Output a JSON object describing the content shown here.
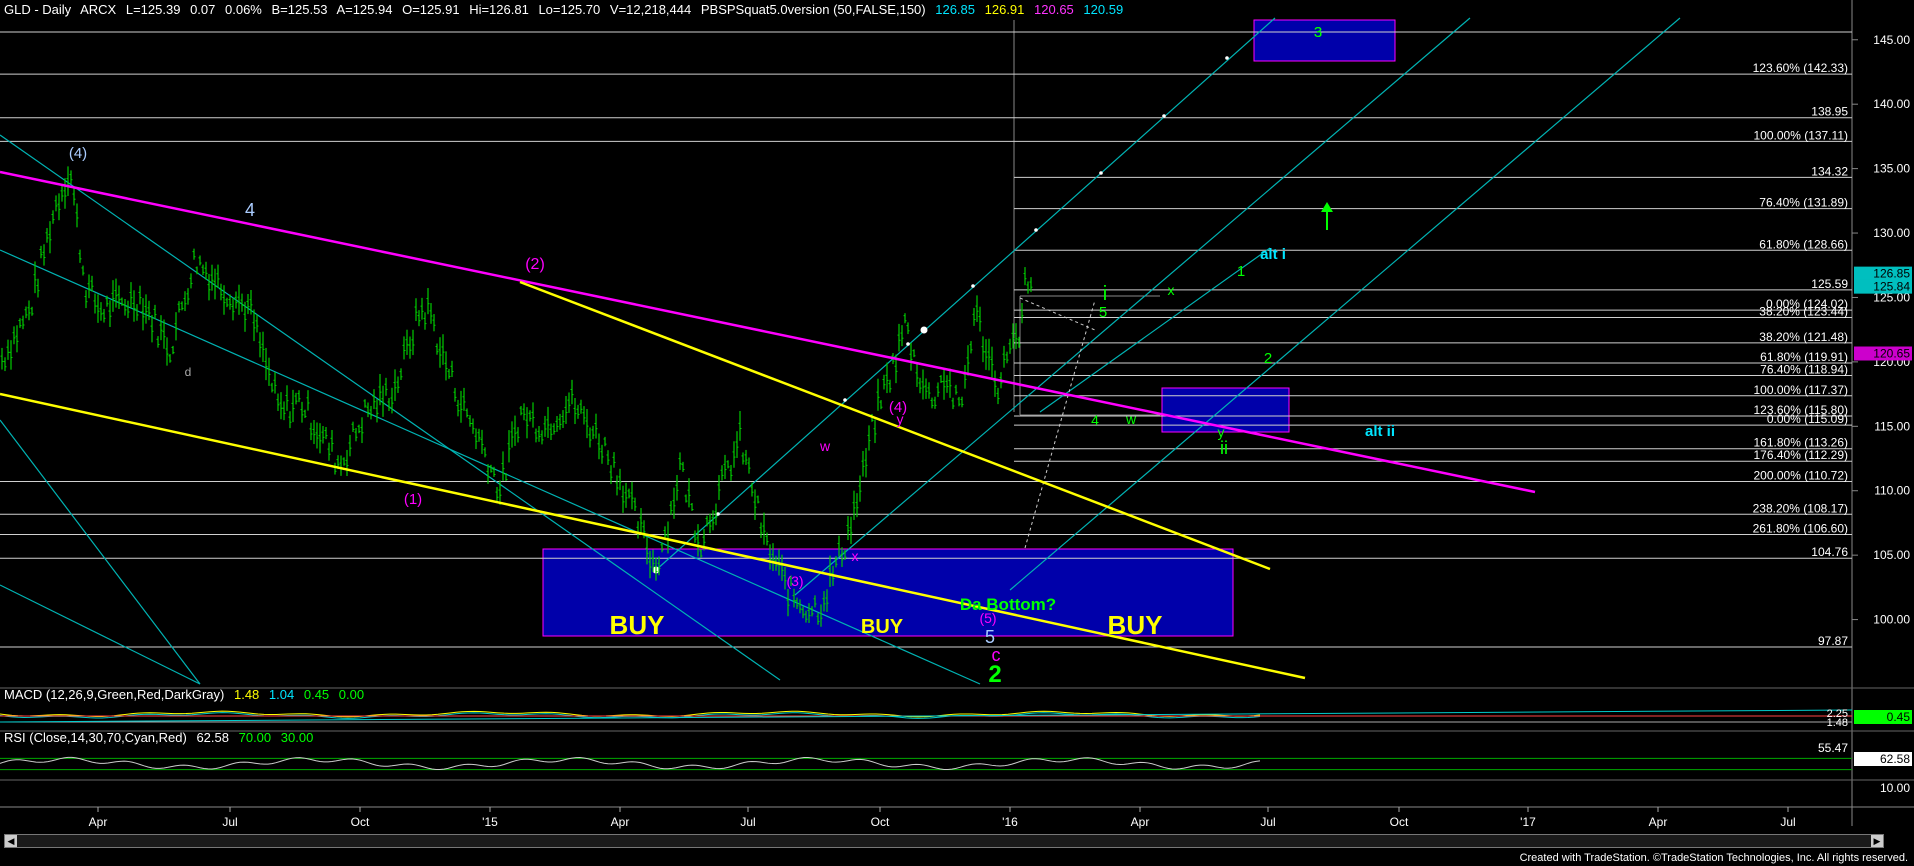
{
  "header": {
    "symbol": "GLD - Daily",
    "exchange": "ARCX",
    "last": "L=125.39",
    "change": "0.07",
    "change_pct": "0.06%",
    "bid": "B=125.53",
    "ask": "A=125.94",
    "open": "O=125.91",
    "high": "Hi=126.81",
    "low": "Lo=125.70",
    "volume": "V=12,218,444",
    "study": "PBSPSquat5.0version (50,FALSE,150)",
    "study_vals": [
      "126.85",
      "126.91",
      "120.65",
      "120.59"
    ],
    "study_colors": [
      "#00e5ff",
      "#ffff00",
      "#ff33ff",
      "#00e5ff"
    ]
  },
  "macd_header": {
    "label": "MACD (12,26,9,Green,Red,DarkGray)",
    "vals": [
      "1.48",
      "1.04",
      "0.45",
      "0.00"
    ],
    "colors": [
      "#ffff00",
      "#00e5ff",
      "#00ff00",
      "#00ff00"
    ]
  },
  "rsi_header": {
    "label": "RSI (Close,14,30,70,Cyan,Red)",
    "vals": [
      "62.58",
      "70.00",
      "30.00"
    ],
    "colors": [
      "#ffffff",
      "#00ff00",
      "#00ff00"
    ]
  },
  "credit": "Created with TradeStation. ©TradeStation Technologies, Inc. All rights reserved.",
  "colors": {
    "bars": "#00cc00",
    "magenta": "#ff00ff",
    "yellow": "#ffff00",
    "cyan": "#00cccc",
    "box": "#0000aa",
    "fib": "#ffffff"
  },
  "chart_data": {
    "type": "candlestick",
    "title": "GLD - Daily",
    "ylim": [
      95,
      147
    ],
    "y_ticks": [
      "145.00",
      "140.00",
      "135.00",
      "130.00",
      "125.00",
      "120.00",
      "115.00",
      "110.00",
      "105.00",
      "100.00"
    ],
    "x_labels": [
      "Apr",
      "Jul",
      "Oct",
      "'15",
      "Apr",
      "Jul",
      "Oct",
      "'16",
      "Apr",
      "Jul",
      "Oct",
      "'17",
      "Apr",
      "Jul"
    ],
    "price_path": [
      [
        0,
        120
      ],
      [
        30,
        124
      ],
      [
        55,
        132
      ],
      [
        70,
        135
      ],
      [
        85,
        126
      ],
      [
        100,
        124
      ],
      [
        140,
        125
      ],
      [
        170,
        121
      ],
      [
        195,
        128
      ],
      [
        220,
        126
      ],
      [
        250,
        124
      ],
      [
        280,
        116
      ],
      [
        300,
        117
      ],
      [
        340,
        112
      ],
      [
        365,
        116
      ],
      [
        395,
        118
      ],
      [
        420,
        124
      ],
      [
        430,
        124
      ],
      [
        440,
        121
      ],
      [
        460,
        117
      ],
      [
        480,
        114
      ],
      [
        500,
        110
      ],
      [
        520,
        116
      ],
      [
        545,
        115
      ],
      [
        570,
        117
      ],
      [
        600,
        114
      ],
      [
        620,
        111
      ],
      [
        635,
        108
      ],
      [
        655,
        104
      ],
      [
        670,
        108
      ],
      [
        680,
        112
      ],
      [
        700,
        106
      ],
      [
        720,
        110
      ],
      [
        740,
        114
      ],
      [
        750,
        111
      ],
      [
        765,
        106
      ],
      [
        790,
        102
      ],
      [
        805,
        101
      ],
      [
        820,
        101
      ],
      [
        830,
        103
      ],
      [
        845,
        106
      ],
      [
        860,
        110
      ],
      [
        870,
        114
      ],
      [
        880,
        117
      ],
      [
        895,
        120
      ],
      [
        905,
        123
      ],
      [
        915,
        120
      ],
      [
        930,
        117
      ],
      [
        945,
        119
      ],
      [
        960,
        116
      ],
      [
        975,
        124
      ],
      [
        990,
        120
      ],
      [
        1000,
        118
      ],
      [
        1010,
        122
      ],
      [
        1020,
        121
      ],
      [
        1025,
        126
      ],
      [
        1033,
        125
      ]
    ],
    "fib_levels": [
      {
        "label": "123.60% (142.33)",
        "value": 142.33
      },
      {
        "label": "138.95",
        "value": 138.95
      },
      {
        "label": "100.00% (137.11)",
        "value": 137.11
      },
      {
        "label": "134.32",
        "value": 134.32
      },
      {
        "label": "76.40% (131.89)",
        "value": 131.89
      },
      {
        "label": "61.80% (128.66)",
        "value": 128.66
      },
      {
        "label": "125.59",
        "value": 125.59
      },
      {
        "label": "0.00% (124.02)",
        "value": 124.02
      },
      {
        "label": "38.20% (123.44)",
        "value": 123.44
      },
      {
        "label": "38.20% (121.48)",
        "value": 121.48
      },
      {
        "label": "61.80% (119.91)",
        "value": 119.91
      },
      {
        "label": "76.40% (118.94)",
        "value": 118.94
      },
      {
        "label": "100.00% (117.37)",
        "value": 117.37
      },
      {
        "label": "123.60% (115.80)",
        "value": 115.8
      },
      {
        "label": "0.00% (115.09)",
        "value": 115.09
      },
      {
        "label": "161.80% (113.26)",
        "value": 113.26
      },
      {
        "label": "176.40% (112.29)",
        "value": 112.29
      },
      {
        "label": "200.00% (110.72)",
        "value": 110.72
      },
      {
        "label": "238.20% (108.17)",
        "value": 108.17
      },
      {
        "label": "261.80% (106.60)",
        "value": 106.6
      },
      {
        "label": "104.76",
        "value": 104.76
      },
      {
        "label": "97.87",
        "value": 97.87
      }
    ],
    "price_tags": [
      {
        "text": "126.85",
        "value": 126.85,
        "bg": "#00bfbf"
      },
      {
        "text": "125.84",
        "value": 125.84,
        "bg": "#00bfbf"
      },
      {
        "text": "120.65",
        "value": 120.65,
        "bg": "#cc00cc"
      }
    ],
    "annotations": [
      {
        "text": "(4)",
        "color": "#aaccff"
      },
      {
        "text": "4",
        "color": "#aaccff"
      },
      {
        "text": "(2)",
        "color": "#ff00ff"
      },
      {
        "text": "(1)",
        "color": "#ff00ff"
      },
      {
        "text": "d",
        "color": "#aaaaaa"
      },
      {
        "text": "(3)",
        "color": "#ff00ff"
      },
      {
        "text": "w",
        "color": "#ff00ff"
      },
      {
        "text": "x",
        "color": "#ff00ff"
      },
      {
        "text": "(4)",
        "color": "#ff00ff"
      },
      {
        "text": "y",
        "color": "#ff00ff"
      },
      {
        "text": "(5)",
        "color": "#ff00ff"
      },
      {
        "text": "5",
        "color": "#aaccff"
      },
      {
        "text": "c",
        "color": "#ff00ff"
      },
      {
        "text": "2",
        "color": "#00ff00"
      },
      {
        "text": "Da Bottom?",
        "color": "#00ff00"
      },
      {
        "text": "BUY",
        "color": "#ffff00"
      },
      {
        "text": "BUY",
        "color": "#ffff00"
      },
      {
        "text": "BUY",
        "color": "#ffff00"
      },
      {
        "text": "3",
        "color": "#00ff00"
      },
      {
        "text": "i",
        "color": "#00ff00"
      },
      {
        "text": "5",
        "color": "#00ff00"
      },
      {
        "text": "4",
        "color": "#00ff00"
      },
      {
        "text": "w",
        "color": "#00ff00"
      },
      {
        "text": "x",
        "color": "#00ff00"
      },
      {
        "text": "y",
        "color": "#00ff00"
      },
      {
        "text": "ii",
        "color": "#00ff00"
      },
      {
        "text": "1",
        "color": "#00ff00"
      },
      {
        "text": "2",
        "color": "#00ff00"
      },
      {
        "text": "alt i",
        "color": "#00e5ff"
      },
      {
        "text": "alt ii",
        "color": "#00e5ff"
      },
      {
        "text": "3",
        "color": "#00ff00"
      }
    ],
    "macd": {
      "macd": 1.48,
      "signal": 1.04,
      "histogram": 0.45,
      "axis_labels": [
        "2.25",
        "1.48",
        "0.45"
      ]
    },
    "rsi": {
      "value": 62.58,
      "overbought": 70,
      "oversold": 30,
      "axis_labels": [
        "55.47",
        "62.58",
        "10.00"
      ]
    }
  }
}
